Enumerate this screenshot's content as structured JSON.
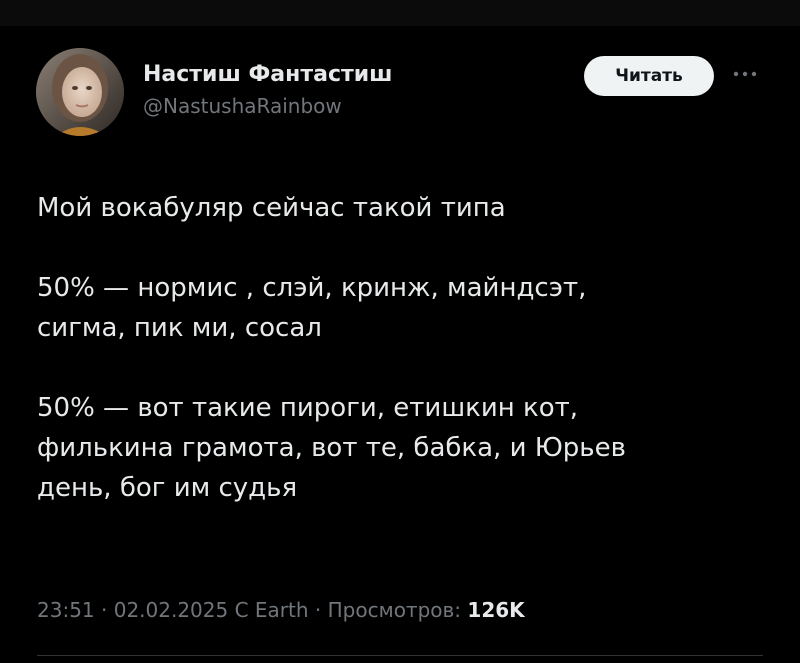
{
  "tweet": {
    "author": {
      "display_name": "Настиш Фантастиш",
      "handle": "@NastushaRainbow",
      "avatar_icon": "user-avatar-photo"
    },
    "follow_label": "Читать",
    "more_icon": "more-horizontal-icon",
    "text": "Мой вокабуляр сейчас такой типа\n\n50% — нормис , слэй, кринж, майндсэт,\nсигма, пик ми, сосал\n\n50% — вот такие пироги, етишкин кот,\nфилькина грамота, вот те, бабка, и Юрьев\nдень, бог им судья",
    "time": "23:51",
    "date": "02.02.2025",
    "source": "C Earth",
    "views_label": "Просмотров:",
    "views_count": "126K",
    "separator": "·"
  },
  "colors": {
    "background": "#000000",
    "text_primary": "#e7e9ea",
    "text_secondary": "#71767b",
    "button_bg": "#eff3f4",
    "button_text": "#0f1419",
    "divider": "#2f3336"
  }
}
